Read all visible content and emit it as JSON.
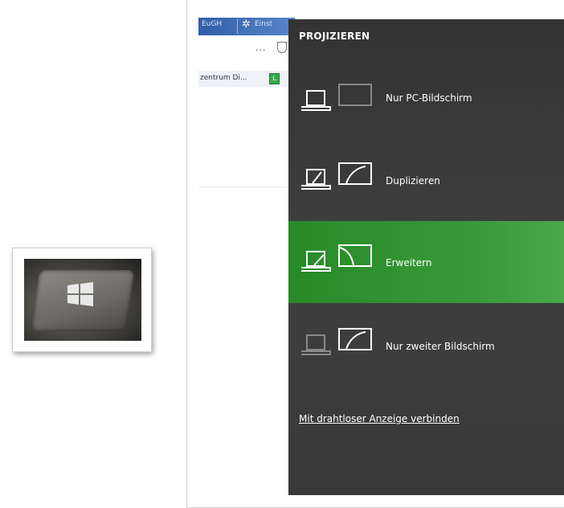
{
  "browser": {
    "bookmark_1": "EuGH",
    "bookmark_2": "Einst",
    "favorites_item": "zentrum Di...",
    "menu_ellipsis": "..."
  },
  "flyout": {
    "title": "PROJIZIEREN",
    "options": [
      {
        "label": "Nur PC-Bildschirm",
        "icon": "pc-screen-only-icon",
        "selected": false
      },
      {
        "label": "Duplizieren",
        "icon": "duplicate-icon",
        "selected": false
      },
      {
        "label": "Erweitern",
        "icon": "extend-icon",
        "selected": true
      },
      {
        "label": "Nur zweiter Bildschirm",
        "icon": "second-screen-only-icon",
        "selected": false
      }
    ],
    "wireless_link": "Mit drahtloser Anzeige verbinden"
  },
  "colors": {
    "flyout_bg": "#3b3b3b",
    "selected_bg": "#2f8f2f",
    "text": "#ffffff"
  }
}
